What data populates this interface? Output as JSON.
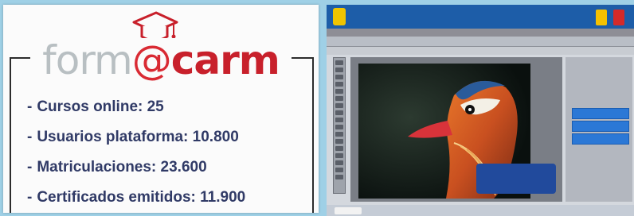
{
  "logo": {
    "part_light": "form",
    "part_at": "@",
    "part_bold": "carm"
  },
  "stats": [
    {
      "dash": "-",
      "text": "Cursos online: 25"
    },
    {
      "dash": "-",
      "text": "Usuarios plataforma: 10.800"
    },
    {
      "dash": "-",
      "text": "Matriculaciones: 23.600"
    },
    {
      "dash": "-",
      "text": "Certificados emitidos: 11.900"
    }
  ],
  "icons": {
    "cap": "graduation-cap-icon"
  },
  "colors": {
    "brand_red": "#c8202b",
    "brand_grey": "#b8bfc2",
    "stat_text": "#303a66",
    "frame": "#2c2c2c",
    "background": "#9fd0e6",
    "screenshot_header": "#1d5da8"
  }
}
